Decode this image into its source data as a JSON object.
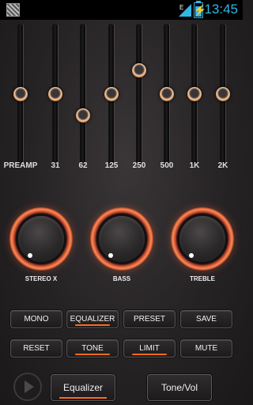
{
  "status_bar": {
    "time": "13:45",
    "battery_level": 0.7,
    "icons": [
      "notification-icon",
      "wifi-icon",
      "signal-icon",
      "battery-charging-icon"
    ]
  },
  "equalizer": {
    "bands": [
      {
        "label": "PREAMP",
        "level": 0.5
      },
      {
        "label": "31",
        "level": 0.5
      },
      {
        "label": "62",
        "level": 0.33
      },
      {
        "label": "125",
        "level": 0.5
      },
      {
        "label": "250",
        "level": 0.69
      },
      {
        "label": "500",
        "level": 0.5
      },
      {
        "label": "1K",
        "level": 0.5
      },
      {
        "label": "2K",
        "level": 0.5
      }
    ]
  },
  "knobs": [
    {
      "label": "STEREO X"
    },
    {
      "label": "BASS"
    },
    {
      "label": "TREBLE"
    }
  ],
  "buttons": {
    "row1": [
      {
        "label": "MONO",
        "active": false
      },
      {
        "label": "EQUALIZER",
        "active": true
      },
      {
        "label": "PRESET",
        "active": false
      },
      {
        "label": "SAVE",
        "active": false
      }
    ],
    "row2": [
      {
        "label": "RESET",
        "active": false
      },
      {
        "label": "TONE",
        "active": true
      },
      {
        "label": "LIMIT",
        "active": true
      },
      {
        "label": "MUTE",
        "active": false
      }
    ]
  },
  "bottom": {
    "equalizer_tab": "Equalizer",
    "tonevol_tab": "Tone/Vol"
  },
  "colors": {
    "accent": "#ff6a1a",
    "status_accent": "#33b5e5"
  }
}
